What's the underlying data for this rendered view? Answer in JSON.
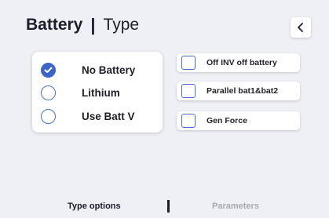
{
  "header": {
    "title": "Battery",
    "separator": "|",
    "subtitle": "Type",
    "back_icon": "chevron-left-icon"
  },
  "battery_options": [
    {
      "label": "No Battery",
      "checked": true
    },
    {
      "label": "Lithium",
      "checked": false
    },
    {
      "label": "Use Batt V",
      "checked": false
    }
  ],
  "check_options": [
    {
      "label": "Off INV off battery",
      "checked": false
    },
    {
      "label": "Parallel bat1&bat2",
      "checked": false
    },
    {
      "label": "Gen Force",
      "checked": false
    }
  ],
  "tabs": {
    "active": "Type options",
    "separator": "|",
    "inactive": "Parameters"
  },
  "colors": {
    "accent": "#3b66c8",
    "background": "#eef0f6",
    "inactive_tab": "#a8a8b2"
  }
}
